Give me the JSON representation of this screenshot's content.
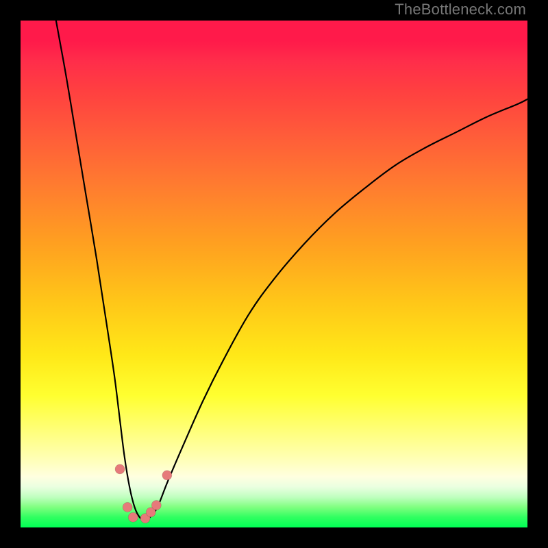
{
  "attribution": "TheBottleneck.com",
  "chart_data": {
    "type": "line",
    "title": "",
    "xlabel": "",
    "ylabel": "",
    "xlim": [
      0,
      100
    ],
    "ylim": [
      0,
      100
    ],
    "grid": false,
    "legend": null,
    "series": [
      {
        "name": "curve",
        "x": [
          7,
          9,
          11,
          13,
          15,
          17,
          18.5,
          19.5,
          20.5,
          21.5,
          22.5,
          23.5,
          24.5,
          25.5,
          27,
          29,
          32,
          36,
          40,
          45,
          50,
          56,
          62,
          68,
          74,
          80,
          86,
          92,
          98,
          100
        ],
        "y": [
          100,
          89,
          77,
          65,
          53,
          40,
          30,
          22,
          14,
          8,
          4,
          2,
          1.5,
          2,
          4,
          9,
          16,
          25,
          33,
          42,
          49,
          56,
          62,
          67,
          71.5,
          75,
          78,
          81,
          83.5,
          84.5
        ]
      }
    ],
    "markers": {
      "name": "highlights",
      "points": [
        {
          "x": 19.6,
          "y": 11.5
        },
        {
          "x": 21.1,
          "y": 4.0
        },
        {
          "x": 22.2,
          "y": 2.0
        },
        {
          "x": 24.6,
          "y": 1.8
        },
        {
          "x": 25.7,
          "y": 3.0
        },
        {
          "x": 26.8,
          "y": 4.4
        },
        {
          "x": 28.9,
          "y": 10.3
        }
      ]
    },
    "colors": {
      "curve": "#000000",
      "marker_fill": "#e67a7a",
      "gradient_top": "#ff1a4a",
      "gradient_bottom": "#00ff55"
    }
  }
}
